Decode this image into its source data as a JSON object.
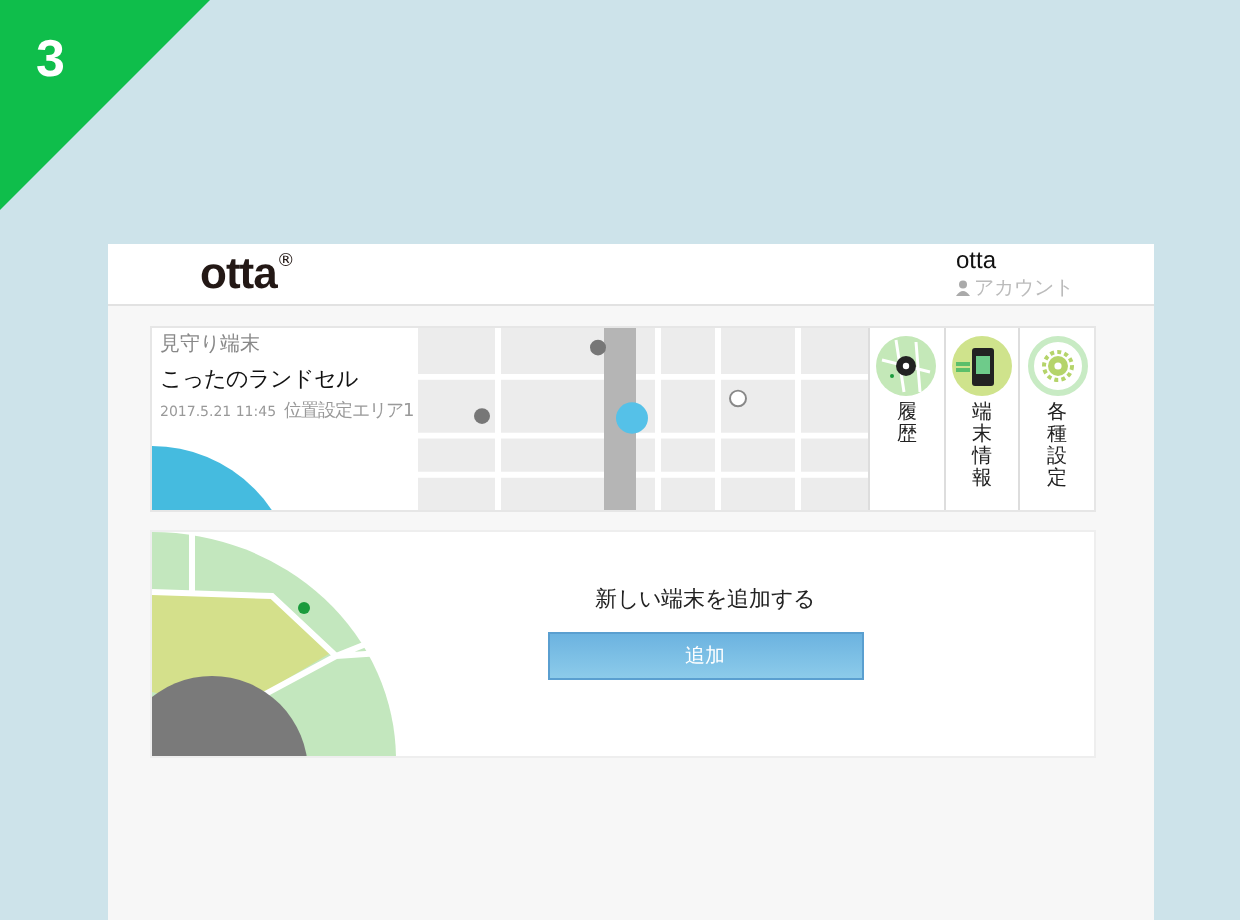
{
  "step_badge": "3",
  "header": {
    "logo": "otta",
    "logo_mark": "®",
    "user_name": "otta",
    "account_label": "アカウント"
  },
  "device_card": {
    "category": "見守り端末",
    "device_name": "こったのランドセル",
    "time": "2017.5.21 11:45",
    "place": "位置設定エリア1",
    "actions": [
      {
        "label": "履歴",
        "kind": "history"
      },
      {
        "label": "端末情報",
        "kind": "device"
      },
      {
        "label": "各種設定",
        "kind": "settings"
      }
    ]
  },
  "add_card": {
    "heading": "新しい端末を追加する",
    "button": "追加"
  }
}
